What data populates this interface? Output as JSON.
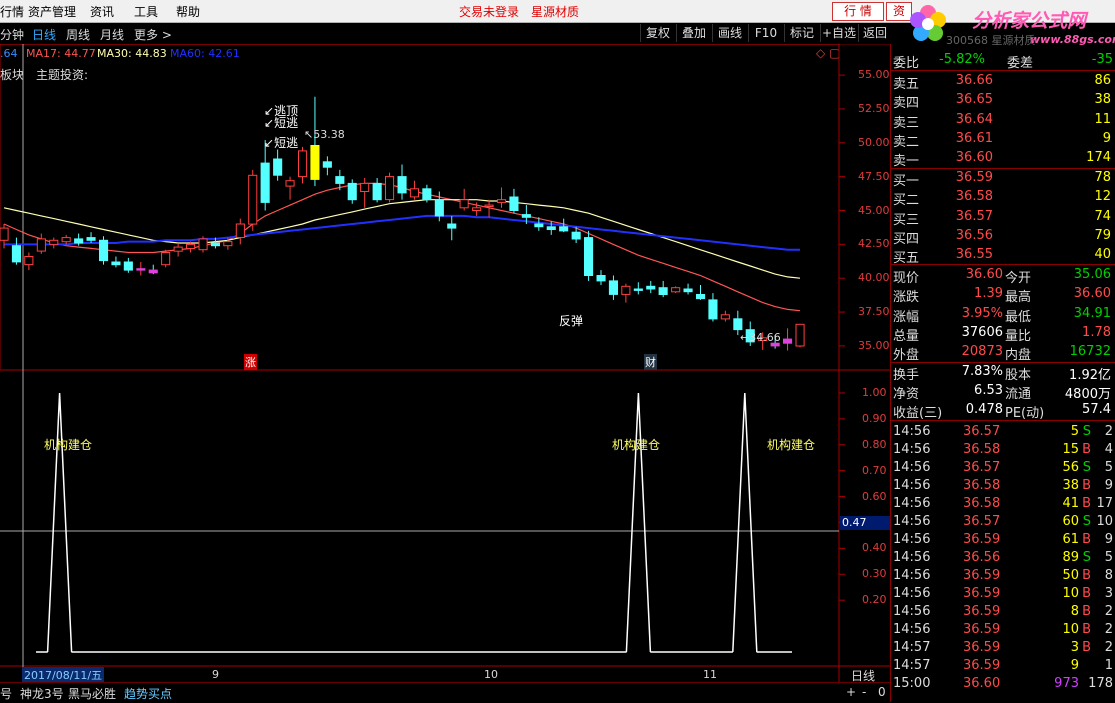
{
  "menubar": {
    "items": [
      "行情",
      "资产管理",
      "资讯",
      "工具",
      "帮助"
    ],
    "trade_status": "交易未登录",
    "stock_name": "星源材质",
    "btn_quote": "行 情",
    "btn_asset": "资"
  },
  "logo": {
    "title": "分析家公式网",
    "url": "www.88gs.com",
    "code_text": "300568 星源材质"
  },
  "toolbar": {
    "tabs": [
      "分钟",
      "日线",
      "周线",
      "月线",
      "更多 >"
    ],
    "active_tab": "日线",
    "buttons": [
      "复权",
      "叠加",
      "画线",
      "F10",
      "标记",
      "+自选",
      "返回"
    ]
  },
  "ma_legend": {
    "ma5": ".64",
    "ma17": "MA17: 44.77",
    "ma30": "MA30: 44.83",
    "ma60": "MA60: 42.61"
  },
  "chart_labels": {
    "sector": "板块",
    "theme": "主题投资:",
    "annotation_top": "逃顶",
    "annotation_short1": "短逃",
    "annotation_short2": "短逃",
    "high_price": "53.38",
    "low_price": "34.66",
    "rebound": "反弹",
    "zhang_badge": "涨",
    "cai_badge": "财",
    "signal_label": "机构建仓",
    "indicator_cursor": "0.47",
    "date_cursor": "2017/08/11/五",
    "period_label": "日线"
  },
  "chart_data": [
    {
      "type": "line",
      "title": "",
      "ylabel": "",
      "ylim": [
        33,
        57
      ],
      "y_ticks": [
        "55.00",
        "52.50",
        "50.00",
        "47.50",
        "45.00",
        "42.50",
        "40.00",
        "37.50",
        "35.00"
      ],
      "x_ticks": [
        "9",
        "10",
        "11"
      ],
      "candles": [
        {
          "o": 42.8,
          "h": 44.0,
          "l": 42.2,
          "c": 43.7
        },
        {
          "o": 42.4,
          "h": 43.0,
          "l": 41.0,
          "c": 41.2
        },
        {
          "o": 41.0,
          "h": 41.9,
          "l": 40.6,
          "c": 41.6
        },
        {
          "o": 42.0,
          "h": 43.3,
          "l": 41.8,
          "c": 42.9
        },
        {
          "o": 42.5,
          "h": 43.0,
          "l": 42.2,
          "c": 42.8
        },
        {
          "o": 42.7,
          "h": 43.2,
          "l": 42.5,
          "c": 43.0
        },
        {
          "o": 42.9,
          "h": 43.3,
          "l": 42.4,
          "c": 42.6
        },
        {
          "o": 43.0,
          "h": 43.4,
          "l": 42.6,
          "c": 42.8
        },
        {
          "o": 42.8,
          "h": 43.1,
          "l": 41.0,
          "c": 41.3
        },
        {
          "o": 41.2,
          "h": 41.6,
          "l": 40.8,
          "c": 41.0
        },
        {
          "o": 41.2,
          "h": 41.5,
          "l": 40.4,
          "c": 40.6
        },
        {
          "o": 40.6,
          "h": 41.2,
          "l": 40.2,
          "c": 40.7
        },
        {
          "o": 40.6,
          "h": 41.0,
          "l": 40.3,
          "c": 40.4
        },
        {
          "o": 41.0,
          "h": 42.1,
          "l": 40.8,
          "c": 41.9
        },
        {
          "o": 42.0,
          "h": 42.6,
          "l": 41.6,
          "c": 42.3
        },
        {
          "o": 42.2,
          "h": 42.7,
          "l": 41.9,
          "c": 42.5
        },
        {
          "o": 42.1,
          "h": 43.1,
          "l": 41.9,
          "c": 42.9
        },
        {
          "o": 42.6,
          "h": 43.0,
          "l": 42.2,
          "c": 42.4
        },
        {
          "o": 42.4,
          "h": 43.0,
          "l": 42.1,
          "c": 42.7
        },
        {
          "o": 43.0,
          "h": 44.4,
          "l": 42.5,
          "c": 44.0
        },
        {
          "o": 44.0,
          "h": 48.0,
          "l": 43.5,
          "c": 47.6
        },
        {
          "o": 48.5,
          "h": 50.2,
          "l": 45.0,
          "c": 45.6
        },
        {
          "o": 48.8,
          "h": 49.5,
          "l": 47.2,
          "c": 47.6
        },
        {
          "o": 46.8,
          "h": 47.5,
          "l": 45.8,
          "c": 47.2
        },
        {
          "o": 47.5,
          "h": 49.7,
          "l": 47.0,
          "c": 49.4
        },
        {
          "o": 49.8,
          "h": 53.4,
          "l": 46.8,
          "c": 47.3
        },
        {
          "o": 48.6,
          "h": 49.0,
          "l": 47.6,
          "c": 48.2
        },
        {
          "o": 47.5,
          "h": 48.0,
          "l": 46.5,
          "c": 47.0
        },
        {
          "o": 47.0,
          "h": 47.3,
          "l": 45.5,
          "c": 45.8
        },
        {
          "o": 46.4,
          "h": 47.4,
          "l": 45.2,
          "c": 47.0
        },
        {
          "o": 47.0,
          "h": 47.4,
          "l": 45.6,
          "c": 45.8
        },
        {
          "o": 45.8,
          "h": 47.8,
          "l": 45.6,
          "c": 47.5
        },
        {
          "o": 47.5,
          "h": 48.4,
          "l": 45.8,
          "c": 46.3
        },
        {
          "o": 46.0,
          "h": 47.2,
          "l": 45.8,
          "c": 46.6
        },
        {
          "o": 46.6,
          "h": 46.9,
          "l": 45.6,
          "c": 45.8
        },
        {
          "o": 45.8,
          "h": 46.4,
          "l": 44.2,
          "c": 44.6
        },
        {
          "o": 44.0,
          "h": 44.6,
          "l": 42.8,
          "c": 43.7
        },
        {
          "o": 45.2,
          "h": 46.6,
          "l": 45.0,
          "c": 45.8
        },
        {
          "o": 45.0,
          "h": 45.6,
          "l": 44.6,
          "c": 45.2
        },
        {
          "o": 45.3,
          "h": 45.8,
          "l": 44.5,
          "c": 45.4
        },
        {
          "o": 45.6,
          "h": 46.7,
          "l": 45.2,
          "c": 45.8
        },
        {
          "o": 46.0,
          "h": 46.6,
          "l": 44.8,
          "c": 45.0
        },
        {
          "o": 44.7,
          "h": 45.4,
          "l": 44.0,
          "c": 44.5
        },
        {
          "o": 44.0,
          "h": 44.5,
          "l": 43.5,
          "c": 43.8
        },
        {
          "o": 43.8,
          "h": 44.2,
          "l": 43.2,
          "c": 43.6
        },
        {
          "o": 43.8,
          "h": 44.4,
          "l": 43.4,
          "c": 43.5
        },
        {
          "o": 43.4,
          "h": 43.8,
          "l": 42.6,
          "c": 42.9
        },
        {
          "o": 43.0,
          "h": 43.5,
          "l": 39.8,
          "c": 40.2
        },
        {
          "o": 40.2,
          "h": 40.6,
          "l": 39.5,
          "c": 39.8
        },
        {
          "o": 39.8,
          "h": 40.2,
          "l": 38.4,
          "c": 38.8
        },
        {
          "o": 38.8,
          "h": 39.6,
          "l": 38.2,
          "c": 39.4
        },
        {
          "o": 39.2,
          "h": 39.7,
          "l": 38.8,
          "c": 39.1
        },
        {
          "o": 39.4,
          "h": 39.8,
          "l": 38.9,
          "c": 39.2
        },
        {
          "o": 39.3,
          "h": 39.8,
          "l": 38.6,
          "c": 38.8
        },
        {
          "o": 39.0,
          "h": 39.4,
          "l": 38.9,
          "c": 39.3
        },
        {
          "o": 39.2,
          "h": 39.6,
          "l": 38.8,
          "c": 39.0
        },
        {
          "o": 38.8,
          "h": 39.5,
          "l": 38.4,
          "c": 38.5
        },
        {
          "o": 38.4,
          "h": 38.9,
          "l": 36.8,
          "c": 37.0
        },
        {
          "o": 37.0,
          "h": 37.6,
          "l": 36.8,
          "c": 37.3
        },
        {
          "o": 37.0,
          "h": 37.6,
          "l": 35.8,
          "c": 36.2
        },
        {
          "o": 36.2,
          "h": 36.8,
          "l": 35.0,
          "c": 35.3
        },
        {
          "o": 35.4,
          "h": 36.0,
          "l": 34.7,
          "c": 35.6
        },
        {
          "o": 35.2,
          "h": 35.8,
          "l": 34.8,
          "c": 35.0
        },
        {
          "o": 35.2,
          "h": 36.3,
          "l": 34.66,
          "c": 35.5
        },
        {
          "o": 35.0,
          "h": 36.6,
          "l": 34.9,
          "c": 36.6
        }
      ],
      "series": [
        {
          "name": "MA17",
          "color": "#ff5555",
          "values": [
            44.0,
            43.6,
            43.2,
            42.9,
            42.6,
            42.4,
            42.3,
            42.2,
            42.1,
            42.0,
            41.9,
            41.9,
            41.9,
            42.0,
            42.1,
            42.2,
            42.4,
            42.6,
            42.8,
            43.3,
            44.0,
            44.6,
            45.0,
            45.4,
            45.8,
            46.2,
            46.5,
            46.7,
            46.9,
            47.0,
            47.0,
            46.9,
            46.7,
            46.4,
            46.2,
            46.0,
            45.8,
            45.6,
            45.4,
            45.2,
            45.0,
            44.8,
            44.6,
            44.4,
            44.2,
            44.0,
            43.7,
            43.3,
            42.9,
            42.5,
            42.1,
            41.7,
            41.4,
            41.1,
            40.8,
            40.5,
            40.2,
            39.8,
            39.4,
            39.0,
            38.6,
            38.2,
            37.9,
            37.7,
            37.6
          ]
        },
        {
          "name": "MA30",
          "color": "#ffffb0",
          "values": [
            45.2,
            45.0,
            44.8,
            44.6,
            44.4,
            44.2,
            44.0,
            43.8,
            43.6,
            43.4,
            43.2,
            43.0,
            42.8,
            42.7,
            42.6,
            42.6,
            42.6,
            42.7,
            42.8,
            43.0,
            43.2,
            43.4,
            43.6,
            43.8,
            44.0,
            44.3,
            44.5,
            44.7,
            44.9,
            45.1,
            45.3,
            45.5,
            45.6,
            45.7,
            45.8,
            45.8,
            45.8,
            45.8,
            45.8,
            45.7,
            45.7,
            45.6,
            45.5,
            45.4,
            45.3,
            45.2,
            45.0,
            44.8,
            44.5,
            44.2,
            43.9,
            43.6,
            43.3,
            43.0,
            42.7,
            42.4,
            42.1,
            41.8,
            41.5,
            41.2,
            40.9,
            40.6,
            40.3,
            40.1,
            40.0
          ]
        },
        {
          "name": "MA60",
          "color": "#2030ff",
          "values": [
            42.5,
            42.5,
            42.5,
            42.5,
            42.5,
            42.5,
            42.6,
            42.6,
            42.6,
            42.6,
            42.7,
            42.7,
            42.7,
            42.8,
            42.8,
            42.8,
            42.9,
            42.9,
            43.0,
            43.1,
            43.2,
            43.3,
            43.4,
            43.5,
            43.6,
            43.7,
            43.8,
            43.9,
            44.0,
            44.1,
            44.2,
            44.3,
            44.4,
            44.5,
            44.6,
            44.6,
            44.6,
            44.6,
            44.5,
            44.5,
            44.4,
            44.3,
            44.2,
            44.1,
            44.0,
            43.9,
            43.8,
            43.7,
            43.6,
            43.5,
            43.4,
            43.3,
            43.2,
            43.1,
            43.0,
            42.9,
            42.8,
            42.7,
            42.6,
            42.5,
            42.4,
            42.3,
            42.2,
            42.1,
            42.1
          ]
        }
      ]
    },
    {
      "type": "line",
      "title": "",
      "ylim": [
        0,
        1.05
      ],
      "y_ticks": [
        "1.00",
        "0.90",
        "0.80",
        "0.70",
        "0.60",
        "0.50",
        "0.40",
        "0.30",
        "0.20"
      ],
      "series": [
        {
          "name": "",
          "color": "#ffffff",
          "values": [
            0,
            0,
            1,
            0,
            0,
            0,
            0,
            0,
            0,
            0,
            0,
            0,
            0,
            0,
            0,
            0,
            0,
            0,
            0,
            0,
            0,
            0,
            0,
            0,
            0,
            0,
            0,
            0,
            0,
            0,
            0,
            0,
            0,
            0,
            0,
            0,
            0,
            0,
            0,
            0,
            0,
            0,
            0,
            0,
            0,
            0,
            0,
            0,
            0,
            0,
            0,
            1,
            0,
            0,
            0,
            0,
            0,
            0,
            0,
            0,
            1,
            0,
            0,
            0,
            0
          ]
        }
      ]
    }
  ],
  "quote": {
    "weibi_label": "委比",
    "weibi_value": "-5.82%",
    "weicha_label": "委差",
    "weicha_value": "-35",
    "asks": [
      {
        "label": "卖五",
        "price": "36.66",
        "vol": "86"
      },
      {
        "label": "卖四",
        "price": "36.65",
        "vol": "38"
      },
      {
        "label": "卖三",
        "price": "36.64",
        "vol": "11"
      },
      {
        "label": "卖二",
        "price": "36.61",
        "vol": "9"
      },
      {
        "label": "卖一",
        "price": "36.60",
        "vol": "174"
      }
    ],
    "bids": [
      {
        "label": "买一",
        "price": "36.59",
        "vol": "78"
      },
      {
        "label": "买二",
        "price": "36.58",
        "vol": "12"
      },
      {
        "label": "买三",
        "price": "36.57",
        "vol": "74"
      },
      {
        "label": "买四",
        "price": "36.56",
        "vol": "79"
      },
      {
        "label": "买五",
        "price": "36.55",
        "vol": "40"
      }
    ],
    "stats": [
      {
        "l1": "现价",
        "v1": "36.60",
        "c1": "red",
        "l2": "今开",
        "v2": "35.06",
        "c2": "green"
      },
      {
        "l1": "涨跌",
        "v1": "1.39",
        "c1": "red",
        "l2": "最高",
        "v2": "36.60",
        "c2": "red"
      },
      {
        "l1": "涨幅",
        "v1": "3.95%",
        "c1": "red",
        "l2": "最低",
        "v2": "34.91",
        "c2": "green"
      },
      {
        "l1": "总量",
        "v1": "37606",
        "c1": "white",
        "l2": "量比",
        "v2": "1.78",
        "c2": "red"
      },
      {
        "l1": "外盘",
        "v1": "20873",
        "c1": "red",
        "l2": "内盘",
        "v2": "16732",
        "c2": "green"
      }
    ],
    "stats2": [
      {
        "l1": "换手",
        "v1": "7.83%",
        "l2": "股本",
        "v2": "1.92亿"
      },
      {
        "l1": "净资",
        "v1": "6.53",
        "l2": "流通",
        "v2": "4800万"
      },
      {
        "l1": "收益(三)",
        "v1": "0.478",
        "l2": "PE(动)",
        "v2": "57.4"
      }
    ]
  },
  "ticks": [
    {
      "t": "14:56",
      "p": "36.57",
      "v": "5",
      "s": "S",
      "n": "2",
      "pc": "red"
    },
    {
      "t": "14:56",
      "p": "36.58",
      "v": "15",
      "s": "B",
      "n": "4",
      "pc": "red"
    },
    {
      "t": "14:56",
      "p": "36.57",
      "v": "56",
      "s": "S",
      "n": "5",
      "pc": "red"
    },
    {
      "t": "14:56",
      "p": "36.58",
      "v": "38",
      "s": "B",
      "n": "9",
      "pc": "red"
    },
    {
      "t": "14:56",
      "p": "36.58",
      "v": "41",
      "s": "B",
      "n": "17",
      "pc": "red"
    },
    {
      "t": "14:56",
      "p": "36.57",
      "v": "60",
      "s": "S",
      "n": "10",
      "pc": "red"
    },
    {
      "t": "14:56",
      "p": "36.59",
      "v": "61",
      "s": "B",
      "n": "9",
      "pc": "red"
    },
    {
      "t": "14:56",
      "p": "36.56",
      "v": "89",
      "s": "S",
      "n": "5",
      "pc": "red"
    },
    {
      "t": "14:56",
      "p": "36.59",
      "v": "50",
      "s": "B",
      "n": "8",
      "pc": "red"
    },
    {
      "t": "14:56",
      "p": "36.59",
      "v": "10",
      "s": "B",
      "n": "3",
      "pc": "red"
    },
    {
      "t": "14:56",
      "p": "36.59",
      "v": "8",
      "s": "B",
      "n": "2",
      "pc": "red"
    },
    {
      "t": "14:56",
      "p": "36.59",
      "v": "10",
      "s": "B",
      "n": "2",
      "pc": "red"
    },
    {
      "t": "14:57",
      "p": "36.59",
      "v": "3",
      "s": "B",
      "n": "2",
      "pc": "red"
    },
    {
      "t": "14:57",
      "p": "36.59",
      "v": "9",
      "s": "",
      "n": "1",
      "pc": "red"
    },
    {
      "t": "15:00",
      "p": "36.60",
      "v": "973",
      "s": "",
      "n": "178",
      "pc": "red",
      "vc": "magenta"
    }
  ],
  "bottombar": {
    "tabs": [
      "号",
      "神龙3号",
      "黑马必胜",
      "趋势买点"
    ],
    "active_tab": "趋势买点",
    "controls": [
      "+",
      "-",
      "0"
    ]
  }
}
